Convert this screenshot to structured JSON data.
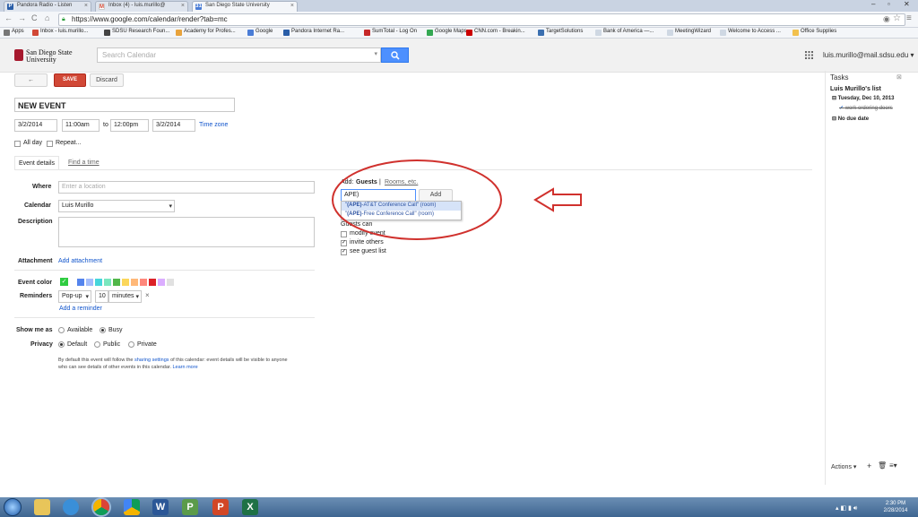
{
  "browser": {
    "tabs": [
      {
        "label": "Pandora Radio - Listen"
      },
      {
        "label": "Inbox (4) - luis.murillo@"
      },
      {
        "label": "San Diego State University"
      }
    ],
    "url": "https://www.google.com/calendar/render?tab=mc",
    "bookmarks": [
      "Apps",
      "Inbox - luis.murillo...",
      "SDSU Research Foun...",
      "Academy for Profes...",
      "Google",
      "Pandora Internet Ra...",
      "SumTotal - Log On",
      "Google Maps",
      "CNN.com - Breakin...",
      "TargetSolutions",
      "Bank of America —...",
      "MeetingWizard",
      "Welcome to Access ...",
      "Office Supplies"
    ]
  },
  "header": {
    "logo_line1": "San Diego State",
    "logo_line2": "University",
    "search_placeholder": "Search Calendar",
    "user_email": "luis.murillo@mail.sdsu.edu"
  },
  "toolbar": {
    "save": "SAVE",
    "discard": "Discard"
  },
  "event": {
    "title": "NEW EVENT",
    "start_date": "3/2/2014",
    "start_time": "11:00am",
    "to": "to",
    "end_time": "12:00pm",
    "end_date": "3/2/2014",
    "timezone": "Time zone",
    "all_day": "All day",
    "repeat": "Repeat..."
  },
  "tabs": {
    "details": "Event details",
    "find_time": "Find a time"
  },
  "form": {
    "where_label": "Where",
    "where_placeholder": "Enter a location",
    "calendar_label": "Calendar",
    "calendar_value": "Luis Murillo",
    "description_label": "Description",
    "attachment_label": "Attachment",
    "add_attachment": "Add attachment",
    "event_color_label": "Event color",
    "reminders_label": "Reminders",
    "reminder_type": "Pop-up",
    "reminder_value": "10",
    "reminder_unit": "minutes",
    "add_reminder": "Add a reminder",
    "show_me_as_label": "Show me as",
    "available": "Available",
    "busy": "Busy",
    "privacy_label": "Privacy",
    "default": "Default",
    "public": "Public",
    "private": "Private",
    "privacy_note_1": "By default this event will follow the",
    "privacy_note_link": "sharing settings",
    "privacy_note_2": "of this calendar: event details will be visible to anyone",
    "privacy_note_3": "who can see details of other events in this calendar.",
    "learn_more": "Learn more"
  },
  "guests": {
    "add_label": "Add:",
    "guests_tab": "Guests",
    "sep": "|",
    "rooms_tab": "Rooms, etc.",
    "input_value": "APE)",
    "add_button": "Add",
    "suggestions": [
      {
        "prefix": "\"",
        "match": "(APE)",
        "rest": "-AT&T Conference Call\" (room)"
      },
      {
        "prefix": "\"",
        "match": "(APE)",
        "rest": "-Free Conference Call\" (room)"
      }
    ],
    "guests_can": "Guests can",
    "modify_event": "modify event",
    "invite_others": "invite others",
    "see_guest_list": "see guest list"
  },
  "tasks": {
    "title": "Tasks",
    "list_name": "Luis Murillo's list",
    "date_group": "Tuesday, Dec 10, 2013",
    "task1": "work ordering doors",
    "no_due": "No due date",
    "actions": "Actions"
  },
  "colors": {
    "swatches": [
      "#2ecc40",
      "#5484ed",
      "#a4bdfc",
      "#46d6db",
      "#7ae7bf",
      "#51b749",
      "#fbd75b",
      "#ffb878",
      "#ff887c",
      "#dc2127",
      "#dbadff",
      "#e1e1e1"
    ],
    "accent_red": "#d14836",
    "search_blue": "#4d90fe",
    "annotation_red": "#d0312d"
  },
  "system": {
    "time": "2:30 PM",
    "date": "2/28/2014"
  }
}
